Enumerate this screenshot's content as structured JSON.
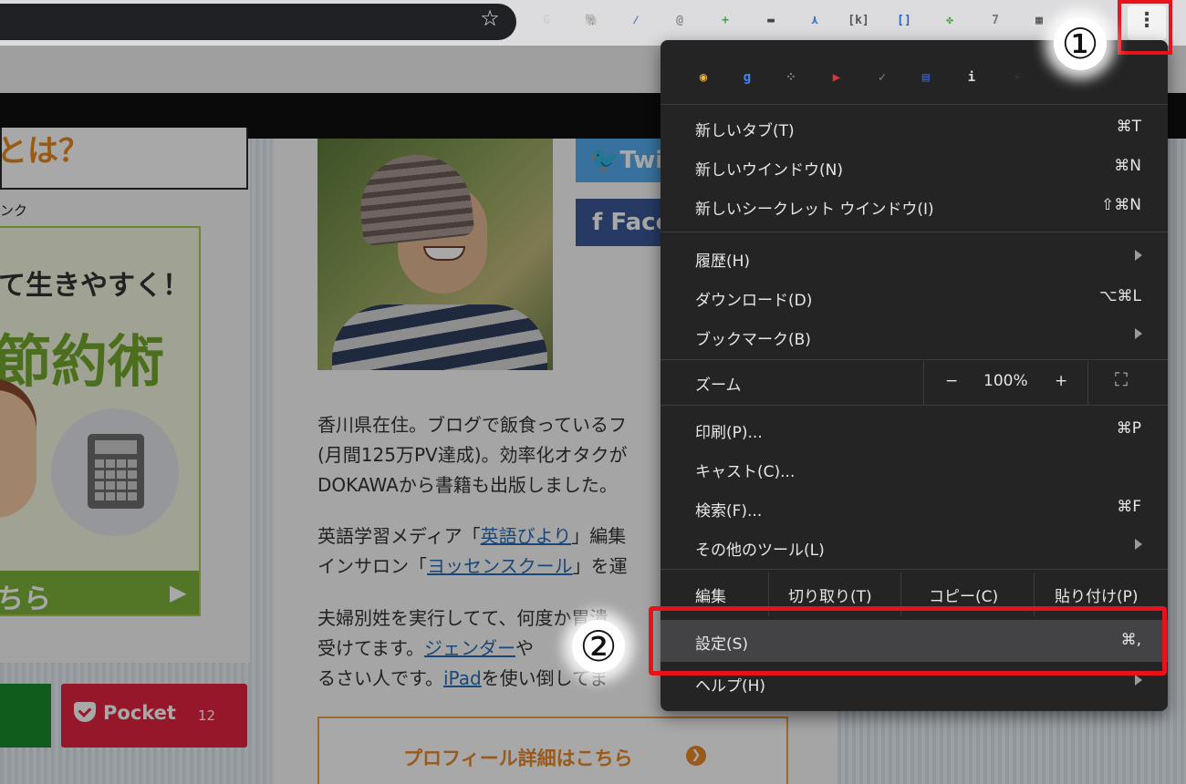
{
  "toolbar": {
    "extensions": [
      {
        "name": "g-extension",
        "glyph": "G"
      },
      {
        "name": "evernote-extension",
        "glyph": "🐘"
      },
      {
        "name": "pen-extension",
        "glyph": "⁄"
      },
      {
        "name": "note-extension",
        "glyph": "@"
      },
      {
        "name": "add-extension",
        "glyph": "+"
      },
      {
        "name": "mask-extension",
        "glyph": "▬"
      },
      {
        "name": "tool-extension",
        "glyph": "⋏"
      },
      {
        "name": "k-extension",
        "glyph": "[k]"
      },
      {
        "name": "bracket-extension",
        "glyph": "[]"
      },
      {
        "name": "puzzle-extension",
        "glyph": "✤"
      },
      {
        "name": "seven-extension",
        "glyph": "7"
      },
      {
        "name": "clapper-extension",
        "glyph": "▦"
      }
    ]
  },
  "page": {
    "heading_fragment": "とは？",
    "link_label": "ンク",
    "banner": {
      "line1": "て生きやすく！",
      "line2": "節約術",
      "cta": "ちら"
    },
    "pocket": {
      "label": "Pocket",
      "count": "12"
    },
    "twitter_label": "Twitt",
    "facebook_label": "Face",
    "bio": [
      {
        "parts": [
          {
            "text": "香川県在住。ブログで飯食っているフ"
          }
        ]
      },
      {
        "parts": [
          {
            "text": "(月間125万PV達成)。効率化オタクが"
          }
        ]
      },
      {
        "parts": [
          {
            "text": "DOKAWAから書籍も出版しました。"
          }
        ]
      },
      {
        "parts": [
          {
            "text": "英語学習メディア「"
          },
          {
            "text": "英語びより",
            "link": true
          },
          {
            "text": "」編集"
          }
        ]
      },
      {
        "parts": [
          {
            "text": "インサロン「"
          },
          {
            "text": "ヨッセンスクール",
            "link": true
          },
          {
            "text": "」を運"
          }
        ]
      },
      {
        "parts": [
          {
            "text": "夫婦別姓を実行してて、何度か胃潰"
          }
        ]
      },
      {
        "parts": [
          {
            "text": "受けてます。"
          },
          {
            "text": "ジェンダー",
            "link": true
          },
          {
            "text": "や"
          }
        ]
      },
      {
        "parts": [
          {
            "text": "るさい人です。"
          },
          {
            "text": "iPad",
            "link": true
          },
          {
            "text": "を使い倒してま"
          }
        ]
      }
    ],
    "profile_button": "プロフィール詳細はこちら"
  },
  "menu": {
    "tray_icons": [
      {
        "name": "compass-extension",
        "glyph": "◉",
        "color": "#f3b13a"
      },
      {
        "name": "google-extension",
        "glyph": "g",
        "color": "#4285f4"
      },
      {
        "name": "grid-extension",
        "glyph": "⁘",
        "color": "#8a8a8a"
      },
      {
        "name": "play-extension",
        "glyph": "▶",
        "color": "#d9363e"
      },
      {
        "name": "check-extension",
        "glyph": "✓",
        "color": "#7d7d7d"
      },
      {
        "name": "screen-extension",
        "glyph": "▤",
        "color": "#3367d6"
      },
      {
        "name": "info-extension",
        "glyph": "i",
        "color": "#dcdcdc"
      },
      {
        "name": "bolt-extension",
        "glyph": "⚡",
        "color": "#3a3a3a"
      }
    ],
    "items_a": [
      {
        "label": "新しいタブ(T)",
        "shortcut": "⌘T"
      },
      {
        "label": "新しいウインドウ(N)",
        "shortcut": "⌘N"
      },
      {
        "label": "新しいシークレット ウインドウ(I)",
        "shortcut": "⇧⌘N"
      }
    ],
    "items_b": [
      {
        "label": "履歴(H)",
        "shortcut": ""
      },
      {
        "label": "ダウンロード(D)",
        "shortcut": "⌥⌘L"
      },
      {
        "label": "ブックマーク(B)",
        "shortcut": ""
      }
    ],
    "zoom": {
      "label": "ズーム",
      "minus": "−",
      "value": "100%",
      "plus": "+"
    },
    "items_c": [
      {
        "label": "印刷(P)...",
        "shortcut": "⌘P"
      },
      {
        "label": "キャスト(C)...",
        "shortcut": ""
      },
      {
        "label": "検索(F)...",
        "shortcut": "⌘F"
      },
      {
        "label": "その他のツール(L)",
        "shortcut": ""
      }
    ],
    "edit": {
      "label": "編集",
      "cut": "切り取り(T)",
      "copy": "コピー(C)",
      "paste": "貼り付け(P)"
    },
    "settings": {
      "label": "設定(S)",
      "shortcut": "⌘,"
    },
    "help": {
      "label": "ヘルプ(H)"
    }
  },
  "annotations": {
    "step1": "①",
    "step2": "②"
  },
  "colors": {
    "highlight": "#e8121a",
    "menu_bg": "#242424",
    "link": "#2a6db5"
  }
}
